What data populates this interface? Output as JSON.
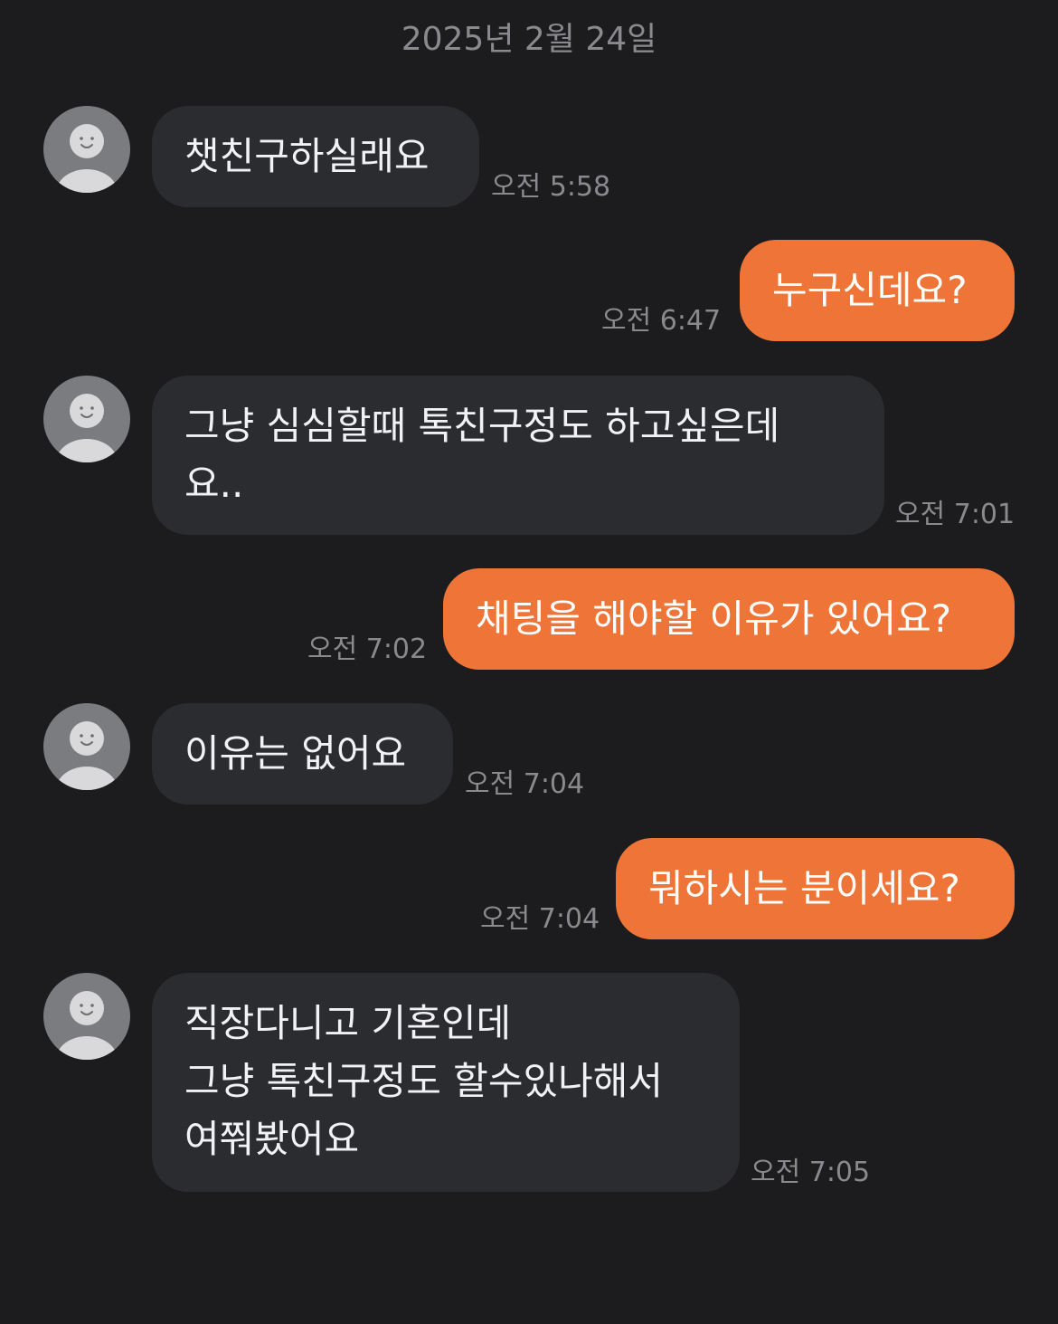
{
  "date_header": "2025년 2월 24일",
  "messages": [
    {
      "sender": "them",
      "text": "챗친구하실래요",
      "time": "오전 5:58"
    },
    {
      "sender": "me",
      "text": "누구신데요?",
      "time": "오전 6:47"
    },
    {
      "sender": "them",
      "text": "그냥 심심할때 톡친구정도 하고싶은데\n요..",
      "time": "오전 7:01"
    },
    {
      "sender": "me",
      "text": "채팅을 해야할 이유가 있어요?",
      "time": "오전 7:02"
    },
    {
      "sender": "them",
      "text": "이유는 없어요",
      "time": "오전 7:04"
    },
    {
      "sender": "me",
      "text": "뭐하시는 분이세요?",
      "time": "오전 7:04"
    },
    {
      "sender": "them",
      "text": "직장다니고 기혼인데\n그냥 톡친구정도 할수있나해서\n여쭤봤어요",
      "time": "오전 7:05"
    }
  ],
  "colors": {
    "background": "#1c1c1e",
    "incoming_bubble": "#2b2c30",
    "outgoing_bubble": "#ee7537",
    "timestamp": "#8a8a8e",
    "avatar": "#7b7c80"
  },
  "icons": {
    "avatar": "default-profile-icon"
  }
}
